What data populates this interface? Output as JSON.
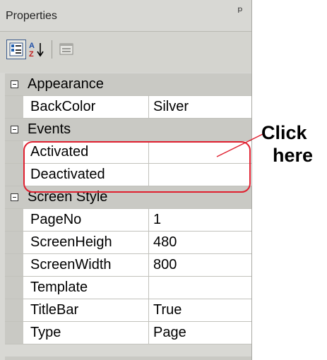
{
  "panel": {
    "title": "Properties",
    "pin_icon": "pin-icon",
    "toolbar": {
      "buttons": [
        {
          "name": "categorized-view",
          "icon": "categorized-icon",
          "active": true
        },
        {
          "name": "alphabetical-sort",
          "icon": "sort-az-icon",
          "glyph": "A↓",
          "active": false
        },
        {
          "name": "property-pages",
          "icon": "property-pages-icon",
          "active": false
        }
      ]
    },
    "categories": [
      {
        "label": "Appearance",
        "properties": [
          {
            "name": "BackColor",
            "value": "Silver"
          }
        ]
      },
      {
        "label": "Events",
        "properties": [
          {
            "name": "Activated",
            "value": ""
          },
          {
            "name": "Deactivated",
            "value": ""
          }
        ]
      },
      {
        "label": "Screen Style",
        "properties": [
          {
            "name": "PageNo",
            "value": "1"
          },
          {
            "name": "ScreenHeigh",
            "value": "480"
          },
          {
            "name": "ScreenWidth",
            "value": "800"
          },
          {
            "name": "Template",
            "value": ""
          },
          {
            "name": "TitleBar",
            "value": "True"
          },
          {
            "name": "Type",
            "value": "Page"
          }
        ]
      }
    ]
  },
  "annotation": {
    "line1": "Click",
    "line2": "here",
    "color": "#e02030"
  }
}
